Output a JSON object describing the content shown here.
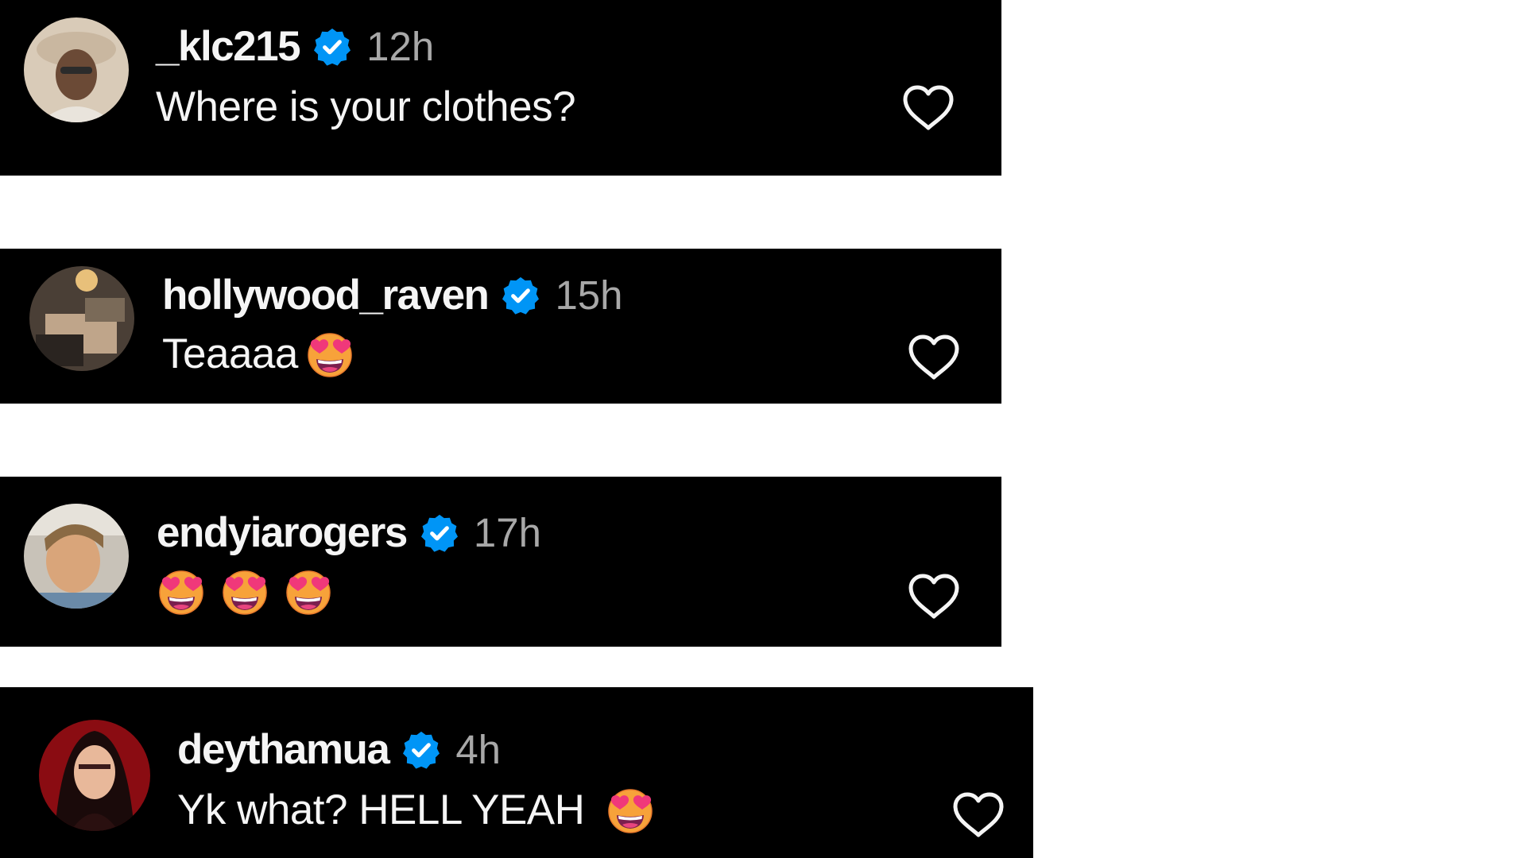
{
  "comments": [
    {
      "username": "_klc215",
      "verified": true,
      "time": "12h",
      "text": "Where is your clothes?",
      "emojis": []
    },
    {
      "username": "hollywood_raven",
      "verified": true,
      "time": "15h",
      "text": "Teaaaa",
      "emojis": [
        "heart-eyes-emoji"
      ]
    },
    {
      "username": "endyiarogers",
      "verified": true,
      "time": "17h",
      "text": "",
      "emojis": [
        "heart-eyes-emoji",
        "heart-eyes-emoji",
        "heart-eyes-emoji"
      ]
    },
    {
      "username": "deythamua",
      "verified": true,
      "time": "4h",
      "text": "Yk what? HELL YEAH",
      "emojis": [
        "heart-eyes-emoji"
      ]
    }
  ],
  "icons": {
    "verified": "verified-badge-icon",
    "like": "heart-outline-icon"
  },
  "colors": {
    "background": "#000000",
    "page": "#ffffff",
    "username": "#f5f5f5",
    "timestamp": "#a8a8a8",
    "verified": "#0095f6"
  }
}
